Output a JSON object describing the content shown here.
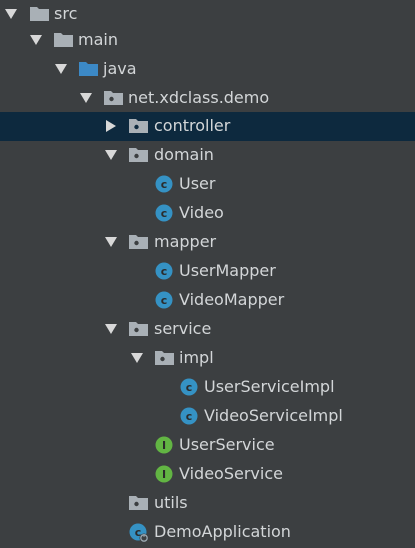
{
  "project_tree": {
    "selected": "controller",
    "nodes": [
      {
        "label": "src",
        "icon": "folder-icon",
        "expanded": true
      },
      {
        "label": "main",
        "icon": "folder-icon",
        "expanded": true
      },
      {
        "label": "java",
        "icon": "source-root-folder-icon",
        "expanded": true
      },
      {
        "label": "net.xdclass.demo",
        "icon": "package-icon",
        "expanded": true
      },
      {
        "label": "controller",
        "icon": "package-icon",
        "expanded": false
      },
      {
        "label": "domain",
        "icon": "package-icon",
        "expanded": true
      },
      {
        "label": "User",
        "icon": "class-icon"
      },
      {
        "label": "Video",
        "icon": "class-icon"
      },
      {
        "label": "mapper",
        "icon": "package-icon",
        "expanded": true
      },
      {
        "label": "UserMapper",
        "icon": "class-icon"
      },
      {
        "label": "VideoMapper",
        "icon": "class-icon"
      },
      {
        "label": "service",
        "icon": "package-icon",
        "expanded": true
      },
      {
        "label": "impl",
        "icon": "package-icon",
        "expanded": true
      },
      {
        "label": "UserServiceImpl",
        "icon": "class-icon"
      },
      {
        "label": "VideoServiceImpl",
        "icon": "class-icon"
      },
      {
        "label": "UserService",
        "icon": "interface-icon"
      },
      {
        "label": "VideoService",
        "icon": "interface-icon"
      },
      {
        "label": "utils",
        "icon": "package-icon"
      },
      {
        "label": "DemoApplication",
        "icon": "spring-boot-class-icon"
      }
    ]
  },
  "colors": {
    "background": "#3c3f41",
    "selection": "#0d293e",
    "text": "#d3d6d8",
    "folder": "#a9b0b6",
    "source_root": "#3c89c6",
    "class_badge": "#3592c4",
    "interface_badge": "#62b543"
  }
}
